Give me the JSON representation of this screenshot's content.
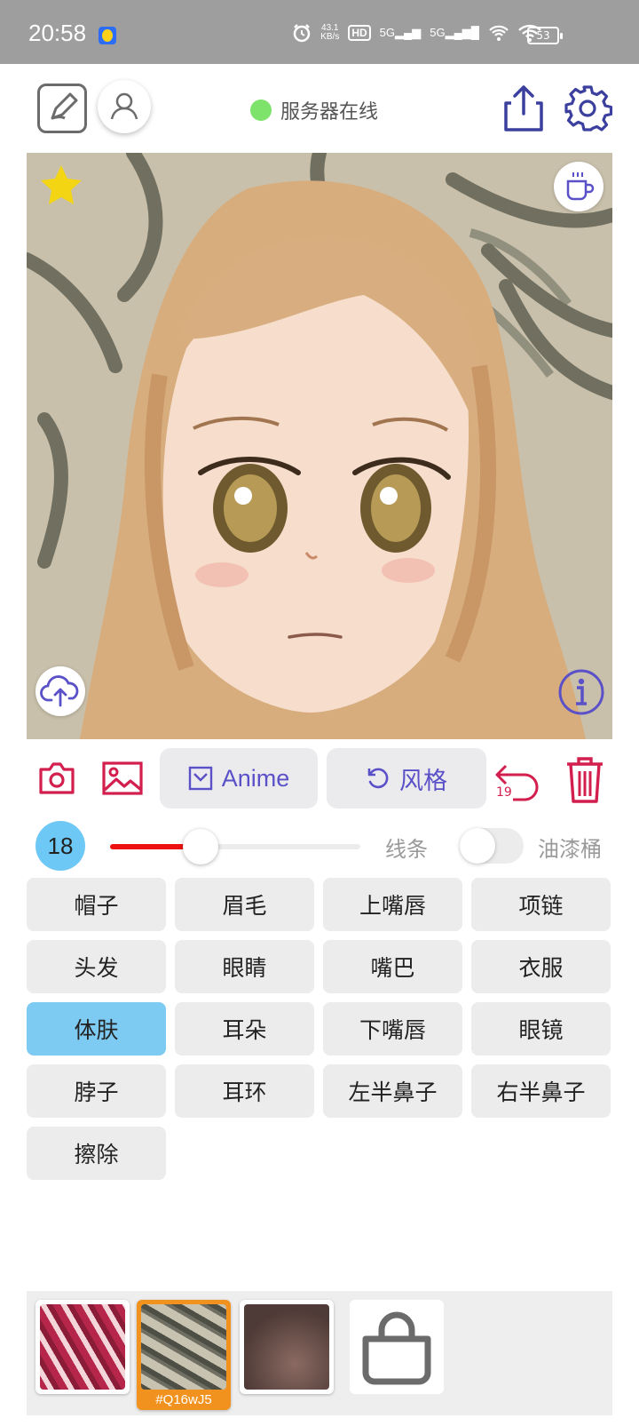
{
  "status_bar": {
    "time": "20:58",
    "net_speed": "43.1",
    "net_speed_unit": "KB/s",
    "hd_label": "HD",
    "sim1_label": "5G",
    "sim2_label": "5G",
    "battery": "53"
  },
  "header": {
    "server_status": "服务器在线",
    "server_status_color": "#7ee36b"
  },
  "toolbar": {
    "anime_label": "Anime",
    "style_label": "风格",
    "undo_count": "19",
    "accent_color": "#d21f4e",
    "pill_text_color": "#5a50c8"
  },
  "brush": {
    "size": "18",
    "slider_fraction": 0.36,
    "line_label": "线条",
    "bucket_label": "油漆桶",
    "bucket_enabled": false
  },
  "parts": [
    {
      "label": "帽子",
      "active": false
    },
    {
      "label": "眉毛",
      "active": false
    },
    {
      "label": "上嘴唇",
      "active": false
    },
    {
      "label": "项链",
      "active": false
    },
    {
      "label": "头发",
      "active": false
    },
    {
      "label": "眼睛",
      "active": false
    },
    {
      "label": "嘴巴",
      "active": false
    },
    {
      "label": "衣服",
      "active": false
    },
    {
      "label": "体肤",
      "active": true
    },
    {
      "label": "耳朵",
      "active": false
    },
    {
      "label": "下嘴唇",
      "active": false
    },
    {
      "label": "眼镜",
      "active": false
    },
    {
      "label": "脖子",
      "active": false
    },
    {
      "label": "耳环",
      "active": false
    },
    {
      "label": "左半鼻子",
      "active": false
    },
    {
      "label": "右半鼻子",
      "active": false
    },
    {
      "label": "擦除",
      "active": false
    }
  ],
  "tray": {
    "selected_code": "#Q16wJ5"
  }
}
